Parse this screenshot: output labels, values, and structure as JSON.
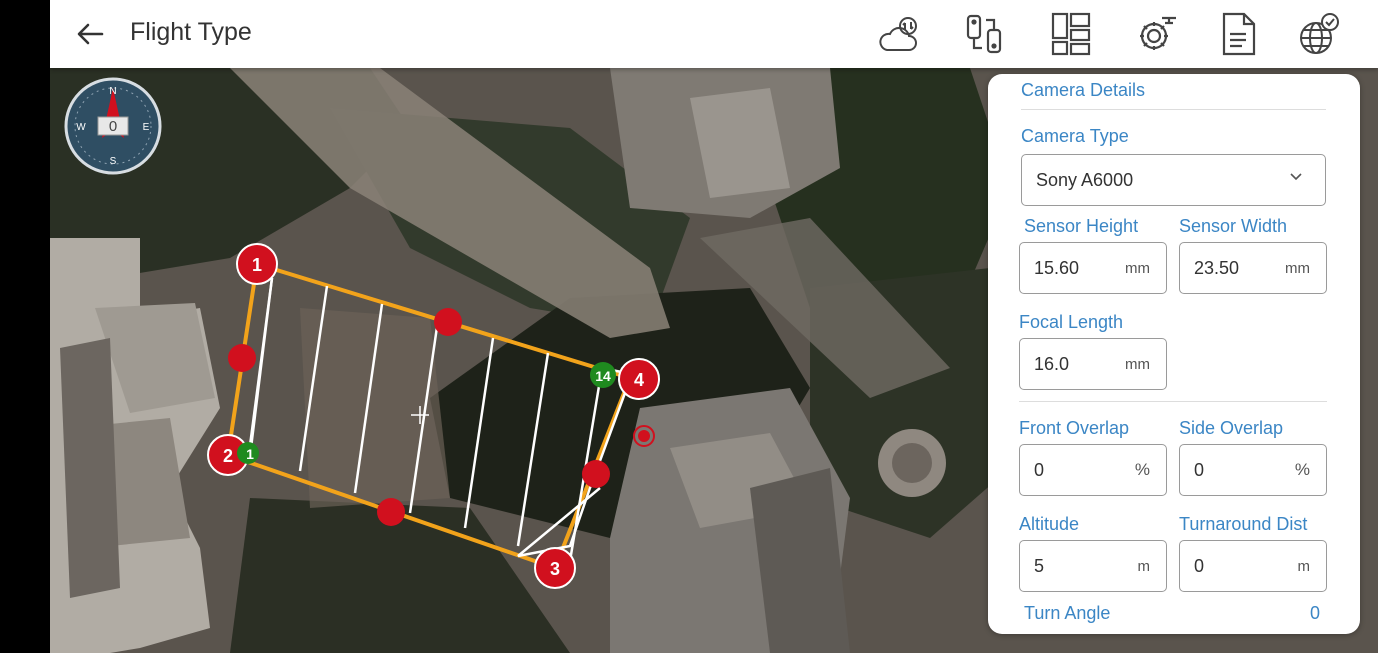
{
  "header": {
    "title": "Flight Type",
    "icons": [
      "back-arrow-icon",
      "cloud-sync-icon",
      "drone-controller-icon",
      "dashboard-icon",
      "drone-settings-icon",
      "document-icon",
      "globe-check-icon"
    ]
  },
  "compass": {
    "heading": "0",
    "n": "N",
    "s": "S",
    "e": "E",
    "w": "W"
  },
  "map": {
    "markers": {
      "m1": "1",
      "m2": "2",
      "m3": "3",
      "m4": "4",
      "g14": "14",
      "g1": "1"
    },
    "colors": {
      "boundary": "#f2a31b",
      "marker": "#d1101e",
      "waypoint": "#1f8a1f",
      "path": "#ffffff"
    }
  },
  "panel": {
    "section_title": "Camera Details",
    "camera_type_label": "Camera Type",
    "camera_type_value": "Sony A6000",
    "sensor_height_label": "Sensor Height",
    "sensor_height_value": "15.60",
    "sensor_height_unit": "mm",
    "sensor_width_label": "Sensor Width",
    "sensor_width_value": "23.50",
    "sensor_width_unit": "mm",
    "focal_length_label": "Focal Length",
    "focal_length_value": "16.0",
    "focal_length_unit": "mm",
    "front_overlap_label": "Front Overlap",
    "front_overlap_value": "0",
    "front_overlap_unit": "%",
    "side_overlap_label": "Side Overlap",
    "side_overlap_value": "0",
    "side_overlap_unit": "%",
    "altitude_label": "Altitude",
    "altitude_value": "5",
    "altitude_unit": "m",
    "turnaround_label": "Turnaround Dist",
    "turnaround_value": "0",
    "turnaround_unit": "m",
    "turn_angle_label": "Turn Angle",
    "turn_angle_value": "0",
    "accent": "#3b86c5"
  }
}
